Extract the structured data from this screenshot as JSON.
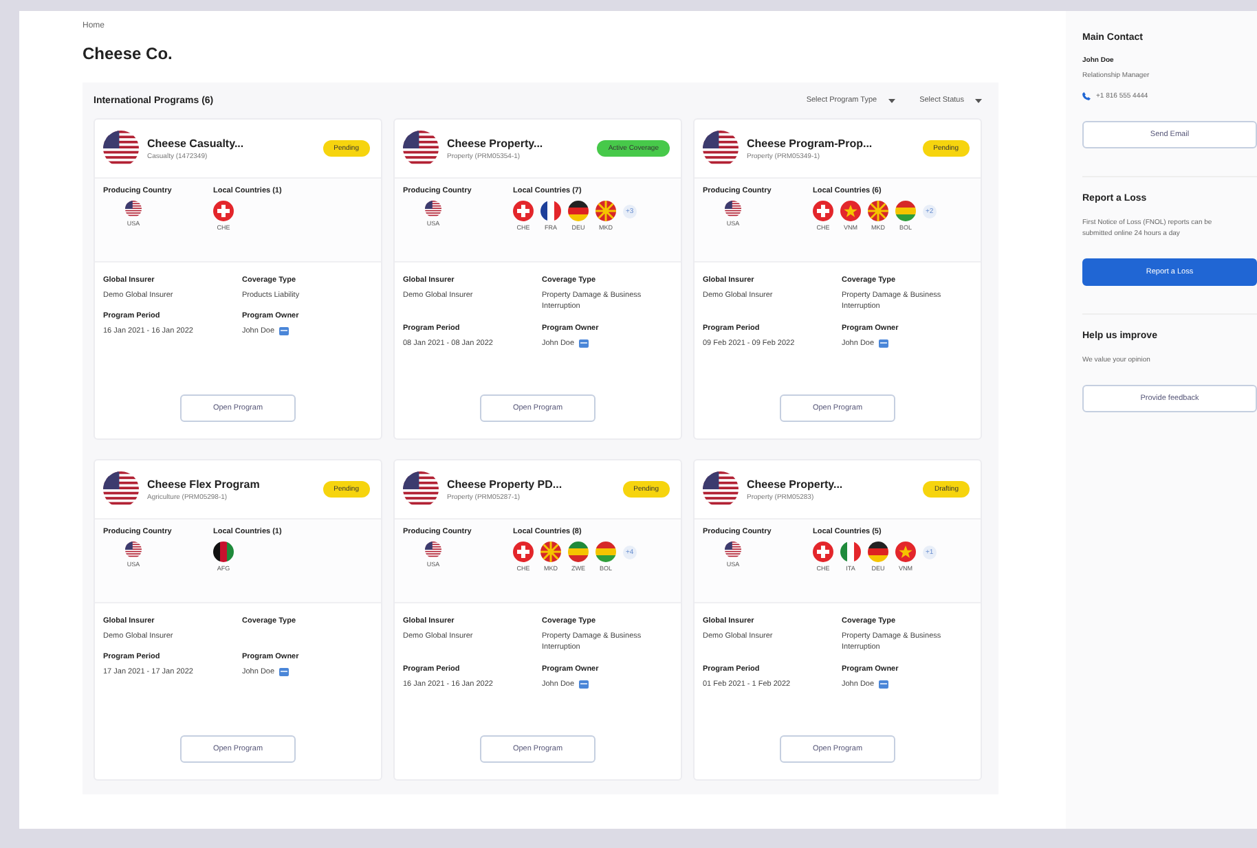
{
  "breadcrumb": "Home",
  "title": "Cheese Co.",
  "programs": {
    "heading": "International Programs (6)",
    "filters": [
      "Select Program Type",
      "Select Status"
    ],
    "cards": [
      {
        "name": "Cheese Casualty...",
        "line": "Casualty (1472349)",
        "badge": {
          "label": "Pending",
          "kind": "pending"
        },
        "producing_label": "Producing Country",
        "producing": {
          "code": "USA",
          "kind": "usa"
        },
        "local_label": "Local Countries (1)",
        "local": [
          {
            "code": "CHE",
            "kind": "che"
          }
        ],
        "insurer_label": "Global Insurer",
        "insurer": "Demo Global Insurer",
        "coverage_label": "Coverage Type",
        "coverage": "Products Liability",
        "period_label": "Program Period",
        "period": "16 Jan 2021 - 16 Jan 2022",
        "owner_label": "Program Owner",
        "owner": "John Doe",
        "button": "Open Program"
      },
      {
        "name": "Cheese Property...",
        "line": "Property (PRM05354-1)",
        "badge": {
          "label": "Active Coverage",
          "kind": "active"
        },
        "producing_label": "Producing Country",
        "producing": {
          "code": "USA",
          "kind": "usa"
        },
        "local_label": "Local Countries (7)",
        "local": [
          {
            "code": "CHE",
            "kind": "che"
          },
          {
            "code": "FRA",
            "kind": "fra"
          },
          {
            "code": "DEU",
            "kind": "deu"
          },
          {
            "code": "MKD",
            "kind": "mkd"
          }
        ],
        "more": "+3",
        "insurer_label": "Global Insurer",
        "insurer": "Demo Global Insurer",
        "coverage_label": "Coverage Type",
        "coverage": "Property Damage & Business Interruption",
        "period_label": "Program Period",
        "period": "08 Jan 2021 - 08 Jan 2022",
        "owner_label": "Program Owner",
        "owner": "John Doe",
        "button": "Open Program"
      },
      {
        "name": "Cheese Program-Prop...",
        "line": "Property (PRM05349-1)",
        "badge": {
          "label": "Pending",
          "kind": "pending"
        },
        "producing_label": "Producing Country",
        "producing": {
          "code": "USA",
          "kind": "usa"
        },
        "local_label": "Local Countries (6)",
        "local": [
          {
            "code": "CHE",
            "kind": "che"
          },
          {
            "code": "VNM",
            "kind": "vnm"
          },
          {
            "code": "MKD",
            "kind": "mkd"
          },
          {
            "code": "BOL",
            "kind": "bol"
          }
        ],
        "more": "+2",
        "insurer_label": "Global Insurer",
        "insurer": "Demo Global Insurer",
        "coverage_label": "Coverage Type",
        "coverage": "Property Damage & Business Interruption",
        "period_label": "Program Period",
        "period": "09 Feb 2021 - 09 Feb 2022",
        "owner_label": "Program Owner",
        "owner": "John Doe",
        "button": "Open Program"
      },
      {
        "name": "Cheese Flex Program",
        "line": "Agriculture (PRM05298-1)",
        "badge": {
          "label": "Pending",
          "kind": "pending"
        },
        "producing_label": "Producing Country",
        "producing": {
          "code": "USA",
          "kind": "usa"
        },
        "local_label": "Local Countries (1)",
        "local": [
          {
            "code": "AFG",
            "kind": "afg"
          }
        ],
        "insurer_label": "Global Insurer",
        "insurer": "Demo Global Insurer",
        "coverage_label": "Coverage Type",
        "period_label": "Program Period",
        "period": "17 Jan 2021 - 17 Jan 2022",
        "owner_label": "Program Owner",
        "owner": "John Doe",
        "button": "Open Program"
      },
      {
        "name": "Cheese Property PD...",
        "line": "Property (PRM05287-1)",
        "badge": {
          "label": "Pending",
          "kind": "pending"
        },
        "producing_label": "Producing Country",
        "producing": {
          "code": "USA",
          "kind": "usa"
        },
        "local_label": "Local Countries (8)",
        "local": [
          {
            "code": "CHE",
            "kind": "che"
          },
          {
            "code": "MKD",
            "kind": "mkd"
          },
          {
            "code": "ZWE",
            "kind": "zwe"
          },
          {
            "code": "BOL",
            "kind": "bol"
          }
        ],
        "more": "+4",
        "insurer_label": "Global Insurer",
        "insurer": "Demo Global Insurer",
        "coverage_label": "Coverage Type",
        "coverage": "Property Damage & Business Interruption",
        "period_label": "Program Period",
        "period": "16 Jan 2021 - 16 Jan 2022",
        "owner_label": "Program Owner",
        "owner": "John Doe",
        "button": "Open Program"
      },
      {
        "name": "Cheese Property...",
        "line": "Property (PRM05283)",
        "badge": {
          "label": "Drafting",
          "kind": "pending"
        },
        "producing_label": "Producing Country",
        "producing": {
          "code": "USA",
          "kind": "usa"
        },
        "local_label": "Local Countries (5)",
        "local": [
          {
            "code": "CHE",
            "kind": "che"
          },
          {
            "code": "ITA",
            "kind": "ita"
          },
          {
            "code": "DEU",
            "kind": "deu"
          },
          {
            "code": "VNM",
            "kind": "vnm"
          }
        ],
        "more": "+1",
        "insurer_label": "Global Insurer",
        "insurer": "Demo Global Insurer",
        "coverage_label": "Coverage Type",
        "coverage": "Property Damage & Business Interruption",
        "period_label": "Program Period",
        "period": "01 Feb 2021 - 1 Feb 2022",
        "owner_label": "Program Owner",
        "owner": "John Doe",
        "button": "Open Program"
      }
    ]
  },
  "sidebar": [
    {
      "kind": "contact",
      "title": "Main Contact",
      "name": "John Doe",
      "role": "Relationship Manager",
      "phone": "+1 816 555 4444",
      "button": "Send Email"
    },
    {
      "kind": "report",
      "title": "Report a Loss",
      "text": "First Notice of Loss (FNOL) reports can be submitted online 24 hours a day",
      "button": "Report a Loss"
    },
    {
      "kind": "feedback",
      "title": "Help us improve",
      "text": "We value your opinion",
      "button": "Provide feedback"
    }
  ]
}
